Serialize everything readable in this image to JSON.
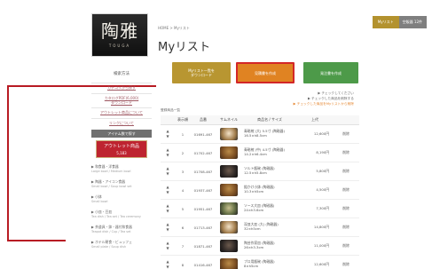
{
  "header": {
    "logo_main": "陶雅",
    "logo_sub": "TOUGA",
    "breadcrumb": "HOME > Myリスト",
    "title": "Myリスト",
    "top_right_badge": "Myリスト",
    "top_right_text": "空販器 12件"
  },
  "buttons": {
    "download": "Myリスト一覧を\nダウンロード",
    "estimate": "見積書を作成",
    "order": "発注書を作成"
  },
  "sidebar": {
    "title": "検索方法",
    "links": [
      "カテゴリから探す",
      "カタログPDF(6,000)\nダウンロード",
      "アウトレット商品について",
      "リンクについて"
    ],
    "section_header": "アイテム数で探す",
    "highlight_main": "アウトレット商品",
    "highlight_sub": "5,183",
    "categories": [
      {
        "title": "▶ 和食器・洋食器",
        "sub": "Large bowl / Medium bowl"
      },
      {
        "title": "▶ 陶器・アイコン食器",
        "sub": "Small bowl / Soup bowl set"
      },
      {
        "title": "▶ 小鉢",
        "sub": "Small bowl"
      },
      {
        "title": "▶ 小皿・豆皿",
        "sub": "Tea dish / Tea set / Tea ceremony"
      },
      {
        "title": "▶ 茶道具・鉢・器付和食器",
        "sub": "Teapot dish / Cup / Tea set"
      },
      {
        "title": "▶ ホテル朝食・ビュッフェ",
        "sub": "Small plate / Soup dish"
      }
    ]
  },
  "helpers": {
    "line1": "▶ チェックしてください",
    "line2": "▶ チェックした商品を削除する",
    "line3": "▶ チェックした商品をMyリストから削除",
    "info": "登録商品一覧"
  },
  "table": {
    "headers": [
      "",
      "表示順",
      "品番",
      "サムネイル",
      "商品名 / サイズ",
      "上代",
      ""
    ],
    "rows": [
      {
        "order": "1",
        "code": "01691-467",
        "name": "青磁椀 (大) 5.5寸 (陶磁器)\n16.5×h8.5cm",
        "price": "12,600円",
        "action": "削除",
        "thumb": "light"
      },
      {
        "order": "2",
        "code": "01702-467",
        "name": "青磁椀 (中) 4.5寸 (陶磁器)\n14.2×h6.4cm",
        "price": "8,190円",
        "action": "削除",
        "thumb": ""
      },
      {
        "order": "3",
        "code": "01708-467",
        "name": "ソルト飯碗 (陶磁器)\n12.5×h5.8cm",
        "price": "5,800円",
        "action": "削除",
        "thumb": "dark"
      },
      {
        "order": "4",
        "code": "01937-467",
        "name": "飴かけ小鉢 (陶磁器)\n10.3×h5cm",
        "price": "4,500円",
        "action": "削除",
        "thumb": ""
      },
      {
        "order": "5",
        "code": "01951-467",
        "name": "ソース大皿 (陶磁器)\n24×h3.6cm",
        "price": "7,300円",
        "action": "削除",
        "thumb": "green"
      },
      {
        "order": "6",
        "code": "01713-467",
        "name": "深皿大皿 (大) (陶磁器)\n32×h5cm",
        "price": "14,800円",
        "action": "削除",
        "thumb": "light"
      },
      {
        "order": "7",
        "code": "01871-467",
        "name": "陶芸作家皿 (陶磁器)\n26×h3.3cm",
        "price": "11,000円",
        "action": "削除",
        "thumb": "dark"
      },
      {
        "order": "8",
        "code": "01416-467",
        "name": "プロ用飯碗 (陶磁器)\n8×h5cm",
        "price": "12,600円",
        "action": "削除",
        "thumb": ""
      }
    ]
  }
}
